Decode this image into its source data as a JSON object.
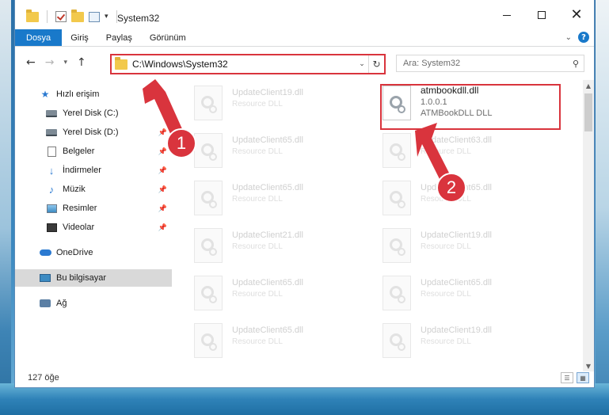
{
  "window": {
    "title": "System32",
    "controls": {
      "minimize": "minimize",
      "maximize": "maximize",
      "close": "✕"
    }
  },
  "ribbon": {
    "tabs": [
      "Dosya",
      "Giriş",
      "Paylaş",
      "Görünüm"
    ],
    "help": "?"
  },
  "address": {
    "path": "C:\\Windows\\System32",
    "search_placeholder": "Ara: System32"
  },
  "sidebar": {
    "items": [
      {
        "label": "Hızlı erişim",
        "icon": "star-icon"
      },
      {
        "label": "Yerel Disk (C:)",
        "icon": "drive-icon"
      },
      {
        "label": "Yerel Disk (D:)",
        "icon": "drive-icon"
      },
      {
        "label": "Belgeler",
        "icon": "documents-icon"
      },
      {
        "label": "İndirmeler",
        "icon": "downloads-icon"
      },
      {
        "label": "Müzik",
        "icon": "music-icon"
      },
      {
        "label": "Resimler",
        "icon": "pictures-icon"
      },
      {
        "label": "Videolar",
        "icon": "videos-icon"
      },
      {
        "label": "OneDrive",
        "icon": "cloud-icon"
      },
      {
        "label": "Bu bilgisayar",
        "icon": "computer-icon",
        "selected": true
      },
      {
        "label": "Ağ",
        "icon": "network-icon"
      }
    ]
  },
  "files": {
    "highlighted": {
      "name": "atmbookdll.dll",
      "version": "1.0.0.1",
      "description": "ATMBookDLL DLL"
    },
    "left_column": [
      {
        "name": "UpdateClient19.dll",
        "type": "Resource DLL"
      },
      {
        "name": "UpdateClient65.dll",
        "type": "Resource DLL"
      },
      {
        "name": "UpdateClient65.dll",
        "type": "Resource DLL"
      },
      {
        "name": "UpdateClient21.dll",
        "type": "Resource DLL"
      },
      {
        "name": "UpdateClient65.dll",
        "type": "Resource DLL"
      },
      {
        "name": "UpdateClient65.dll",
        "type": "Resource DLL"
      }
    ],
    "right_column": [
      {
        "name": "UpdateClient63.dll",
        "type": "Resource DLL"
      },
      {
        "name": "UpdateClient65.dll",
        "type": "Resource DLL"
      },
      {
        "name": "UpdateClient19.dll",
        "type": "Resource DLL"
      },
      {
        "name": "UpdateClient65.dll",
        "type": "Resource DLL"
      },
      {
        "name": "UpdateClient19.dll",
        "type": "Resource DLL"
      }
    ]
  },
  "status": {
    "count": "127 öğe"
  },
  "annotations": {
    "step1": "1",
    "step2": "2"
  },
  "colors": {
    "accent": "#1979ca",
    "highlight": "#d9343d"
  }
}
